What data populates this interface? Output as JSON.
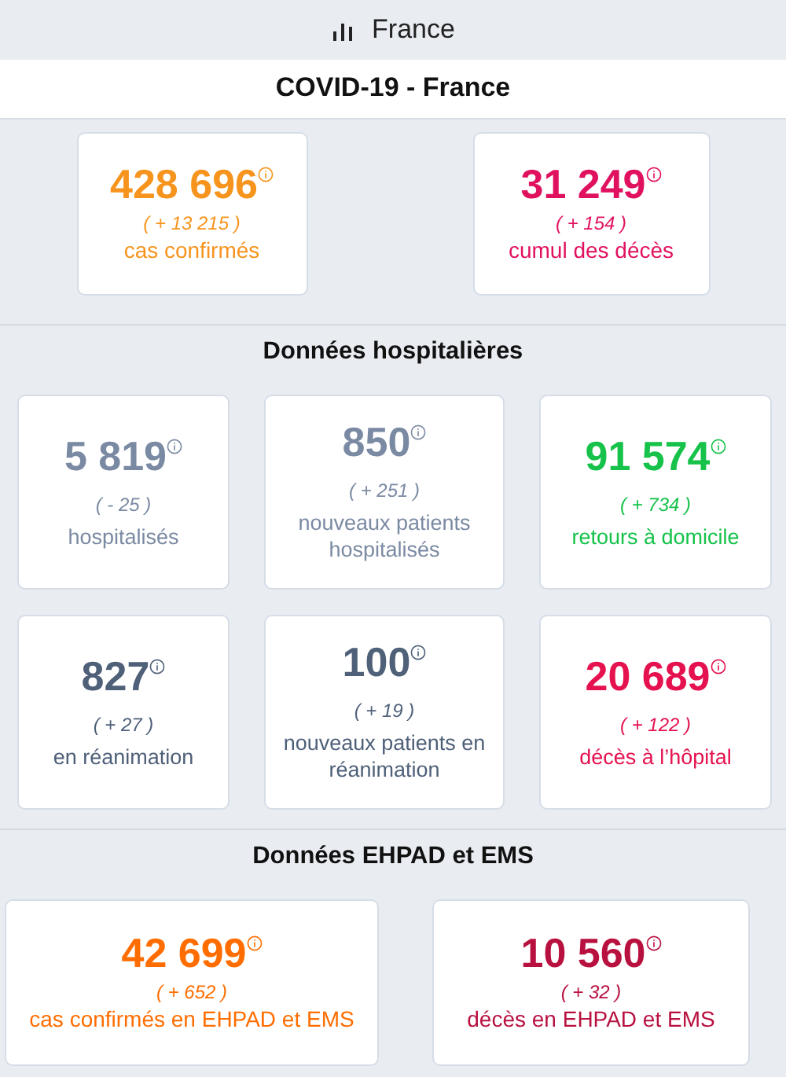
{
  "header": {
    "title": "France"
  },
  "sections": [
    {
      "kind": "banner",
      "title": "COVID-19 - France",
      "cards": [
        {
          "value": "428 696",
          "delta": "( + 13 215 )",
          "label": "cas confirmés",
          "color": "#f7941d"
        },
        {
          "value": "31 249",
          "delta": "( + 154 )",
          "label": "cumul des décès",
          "color": "#e0115f"
        }
      ]
    },
    {
      "kind": "plain",
      "title": "Données hospitalières",
      "cards": [
        {
          "value": "5 819",
          "delta": "( - 25 )",
          "label": "hospitalisés",
          "color": "#7b8aa3"
        },
        {
          "value": "850",
          "delta": "( + 251 )",
          "label": "nouveaux patients hospitalisés",
          "color": "#7b8aa3"
        },
        {
          "value": "91 574",
          "delta": "( + 734 )",
          "label": "retours à domicile",
          "color": "#16c24a"
        },
        {
          "value": "827",
          "delta": "( + 27 )",
          "label": "en réanimation",
          "color": "#4f6079"
        },
        {
          "value": "100",
          "delta": "( + 19 )",
          "label": "nouveaux patients en réanimation",
          "color": "#4f6079"
        },
        {
          "value": "20 689",
          "delta": "( + 122 )",
          "label": "décès à l’hôpital",
          "color": "#e5124f"
        }
      ]
    },
    {
      "kind": "plain",
      "title": "Données EHPAD et EMS",
      "cards": [
        {
          "value": "42 699",
          "delta": "( + 652 )",
          "label": "cas confirmés en EHPAD et EMS",
          "color": "#ff6d00"
        },
        {
          "value": "10 560",
          "delta": "( + 32 )",
          "label": "décès en EHPAD et EMS",
          "color": "#b8113f"
        }
      ]
    }
  ]
}
